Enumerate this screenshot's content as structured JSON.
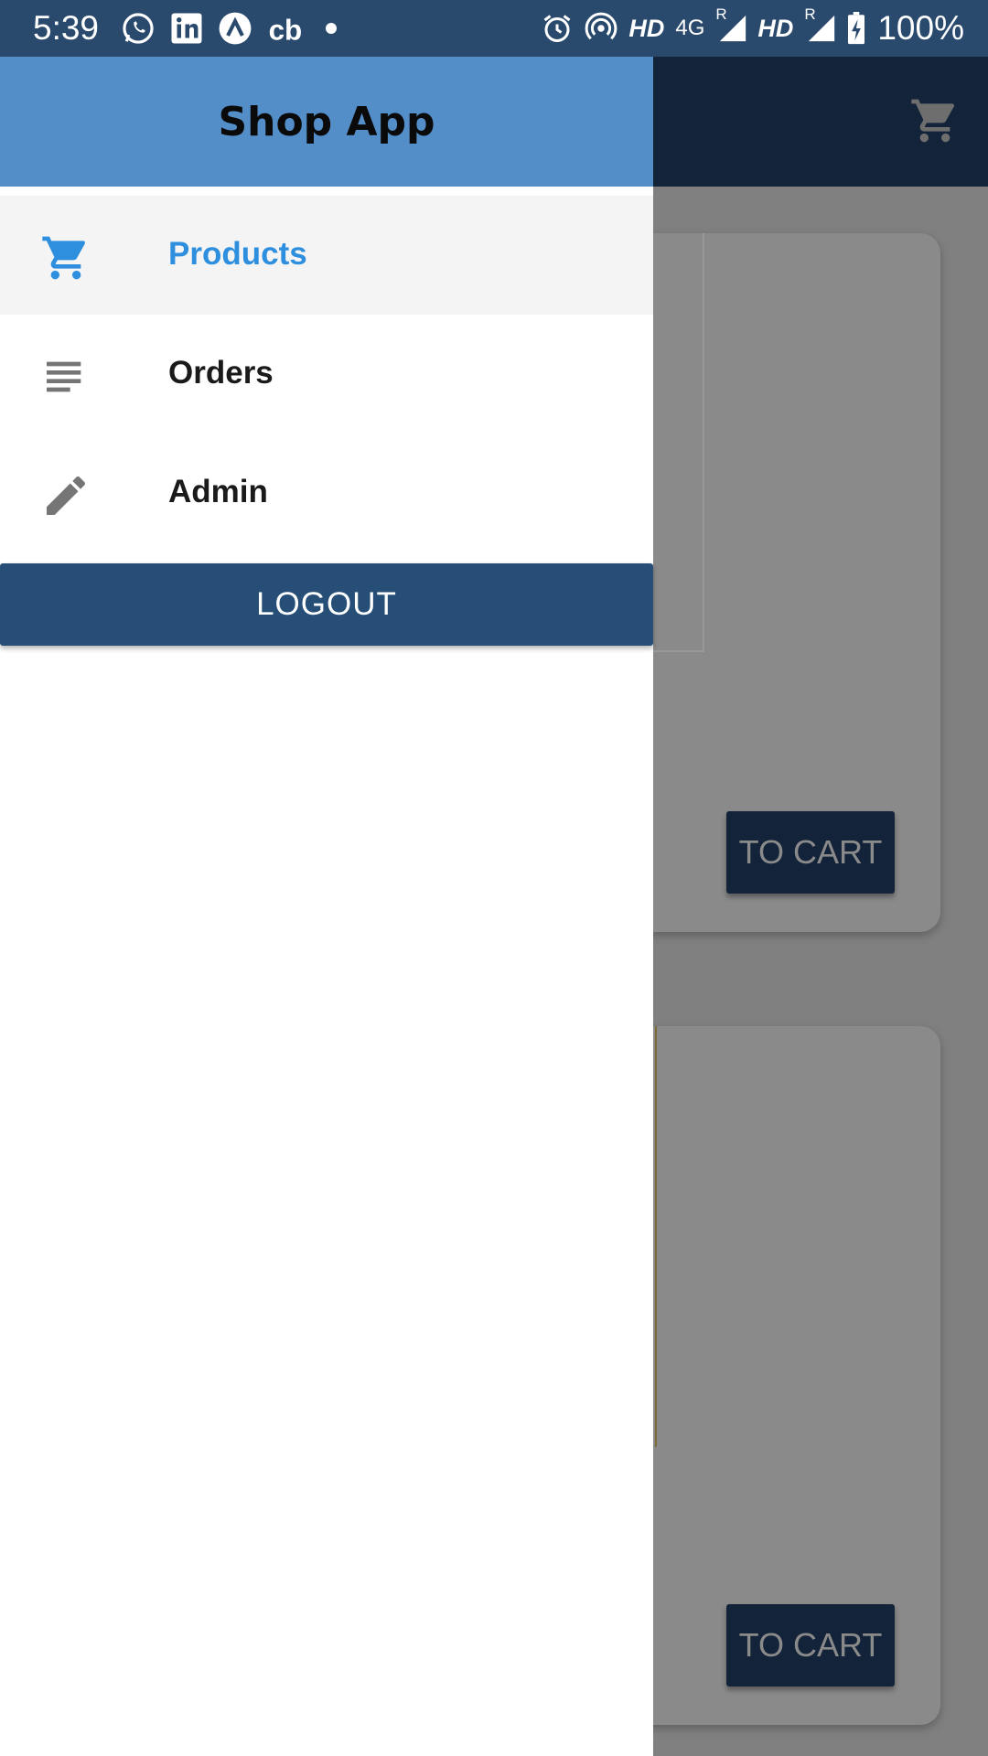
{
  "status_bar": {
    "time": "5:39",
    "left_icons": [
      "whatsapp-icon",
      "linkedin-icon",
      "arc-icon",
      "cb-icon",
      "dot-icon"
    ],
    "hd1": "HD",
    "network": "4G",
    "roaming1": "R",
    "hd2": "HD",
    "roaming2": "R",
    "battery": "100%"
  },
  "drawer": {
    "title": "Shop App",
    "items": [
      {
        "label": "Products",
        "icon": "cart-icon",
        "active": true
      },
      {
        "label": "Orders",
        "icon": "list-icon",
        "active": false
      },
      {
        "label": "Admin",
        "icon": "edit-icon",
        "active": false
      }
    ],
    "logout_label": "LOGOUT"
  },
  "background": {
    "partial_title": "!",
    "card_buttons": [
      "TO CART",
      "TO CART"
    ]
  },
  "colors": {
    "drawer_header": "#548ec9",
    "active_item": "#2e8fde",
    "logout_button": "#264e76",
    "app_bar": "#13233a",
    "scrim": "#7f7f7f"
  }
}
